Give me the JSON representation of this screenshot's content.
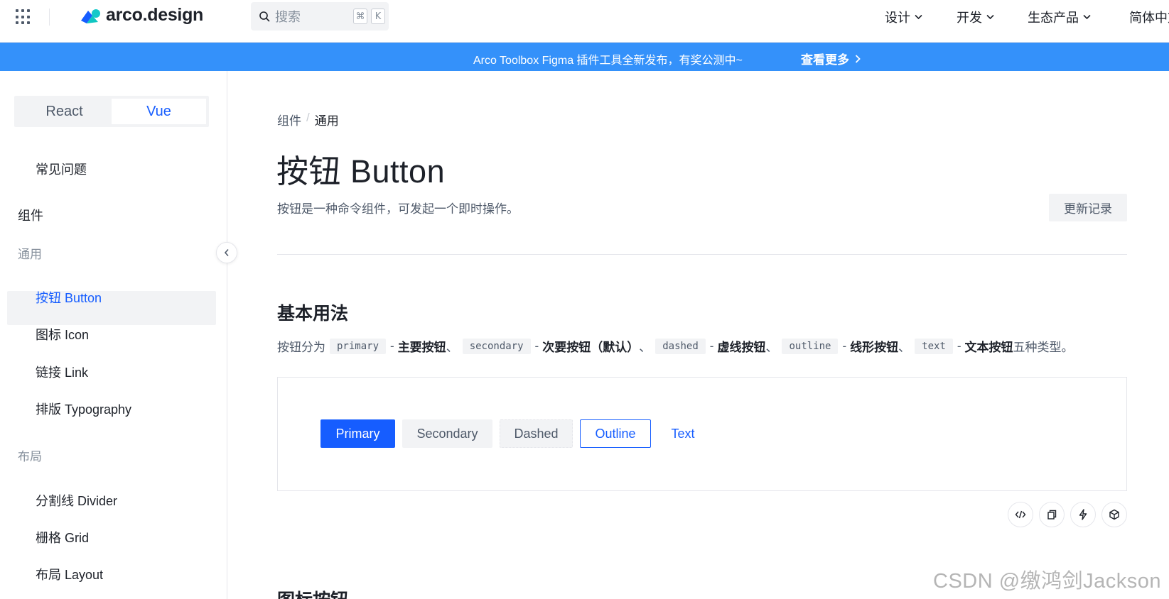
{
  "header": {
    "logo_text": "arco.design",
    "search_placeholder": "搜索",
    "kbd_cmd": "⌘",
    "kbd_key": "K",
    "nav": [
      "设计",
      "开发",
      "生态产品",
      "简体中文"
    ]
  },
  "banner": {
    "text": "Arco Toolbox Figma 插件工具全新发布，有奖公测中~",
    "link": "查看更多"
  },
  "sidebar": {
    "frameworks": [
      "React",
      "Vue"
    ],
    "active_framework": "Vue",
    "faq": "常见问题",
    "group": "组件",
    "categories": [
      "通用",
      "布局"
    ],
    "general_items": [
      "按钮 Button",
      "图标 Icon",
      "链接 Link",
      "排版 Typography"
    ],
    "layout_items": [
      "分割线 Divider",
      "栅格 Grid",
      "布局 Layout"
    ],
    "active_item": "按钮 Button"
  },
  "main": {
    "breadcrumb": [
      "组件",
      "通用"
    ],
    "title": "按钮 Button",
    "description": "按钮是一种命令组件，可发起一个即时操作。",
    "changelog": "更新记录",
    "section": {
      "title": "基本用法",
      "desc_prefix": "按钮分为",
      "types": [
        {
          "code": "primary",
          "label": "主要按钮",
          "after": "、"
        },
        {
          "code": "secondary",
          "label": "次要按钮（默认）",
          "after": "、"
        },
        {
          "code": "dashed",
          "label": "虚线按钮",
          "after": "、"
        },
        {
          "code": "outline",
          "label": "线形按钮",
          "after": "、"
        },
        {
          "code": "text",
          "label": "文本按钮",
          "after": "五种类型。"
        }
      ],
      "dash": "-"
    },
    "demo_buttons": [
      "Primary",
      "Secondary",
      "Dashed",
      "Outline",
      "Text"
    ],
    "toolbar_icons": [
      "code-icon",
      "copy-icon",
      "lightning-icon",
      "cube-icon"
    ],
    "next_section": "图标按钮"
  },
  "watermark": "CSDN @缴鸿剑Jackson",
  "colors": {
    "primary": "#165dff",
    "banner": "#3491fa",
    "bg_fill": "#f2f3f5",
    "text_primary": "#1d2129",
    "text_secondary": "#4e5969",
    "text_muted": "#86909c"
  }
}
